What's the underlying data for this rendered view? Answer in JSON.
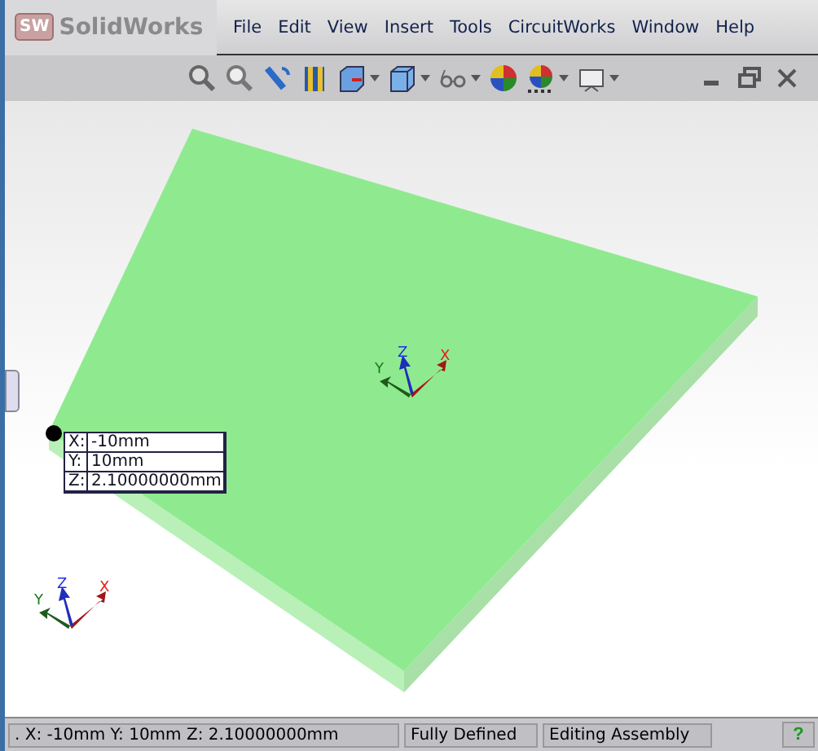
{
  "app": {
    "logo_badge": "SW",
    "logo_text": "SolidWorks"
  },
  "menu": [
    "File",
    "Edit",
    "View",
    "Insert",
    "Tools",
    "CircuitWorks",
    "Window",
    "Help"
  ],
  "viewport": {
    "coordinate_tooltip": [
      {
        "axis": "X:",
        "value": "-10mm"
      },
      {
        "axis": "Y:",
        "value": "10mm"
      },
      {
        "axis": "Z:",
        "value": "2.10000000mm"
      }
    ],
    "triads": [
      {
        "x": "X",
        "y": "Y",
        "z": "Z"
      },
      {
        "x": "X",
        "y": "Y",
        "z": "Z"
      }
    ]
  },
  "status_bar": {
    "coordinates": ". X: -10mm Y: 10mm Z: 2.10000000mm",
    "sketch_state": "Fully Defined",
    "mode": "Editing Assembly",
    "help": "?"
  }
}
